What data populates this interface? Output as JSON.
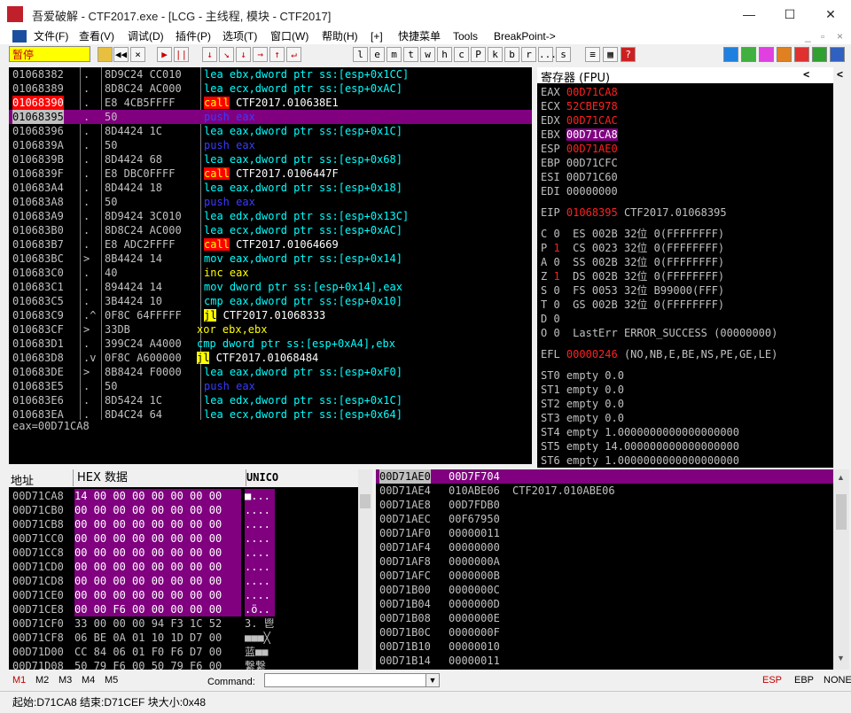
{
  "window": {
    "title": "吾爱破解 - CTF2017.exe - [LCG - 主线程, 模块 - CTF2017]",
    "min": "—",
    "max": "☐",
    "close": "✕"
  },
  "menu": [
    "文件(F)",
    "查看(V)",
    "调试(D)",
    "插件(P)",
    "选项(T)",
    "窗口(W)",
    "帮助(H)",
    "[+]",
    "快捷菜单",
    "Tools",
    "BreakPoint->"
  ],
  "mdi_controls": [
    "_",
    "▫",
    "×"
  ],
  "toolbar": {
    "status": "暂停",
    "debug_buttons": [
      "◀◀",
      "×",
      "▶",
      "||",
      "↓",
      "↘",
      "↓",
      "→",
      "↑",
      "↵"
    ],
    "letter_buttons": [
      "l",
      "e",
      "m",
      "t",
      "w",
      "h",
      "c",
      "P",
      "k",
      "b",
      "r",
      "...",
      "s"
    ]
  },
  "cpu": {
    "rows": [
      {
        "addr": "01068382",
        "mark": ".",
        "hex": "8D9C24 CC010",
        "dis": [
          [
            "lea ebx,dword ptr ss:[esp+0x1CC]",
            "cyan"
          ]
        ]
      },
      {
        "addr": "01068389",
        "mark": ".",
        "hex": "8D8C24 AC000",
        "dis": [
          [
            "lea ecx,dword ptr ss:[esp+0xAC]",
            "cyan"
          ]
        ]
      },
      {
        "addr": "01068390",
        "mark": ".",
        "hex": "E8 4CB5FFFF",
        "addr_hl": "red",
        "dis": [
          [
            "call",
            "callhl"
          ],
          [
            " CTF2017.010638E1",
            "white"
          ]
        ]
      },
      {
        "addr": "01068395",
        "mark": ".",
        "hex": "50",
        "row_hl": "purple",
        "dis": [
          [
            "push eax",
            "blue"
          ]
        ]
      },
      {
        "addr": "01068396",
        "mark": ".",
        "hex": "8D4424 1C",
        "dis": [
          [
            "lea eax,dword ptr ss:[esp+0x1C]",
            "cyan"
          ]
        ]
      },
      {
        "addr": "0106839A",
        "mark": ".",
        "hex": "50",
        "dis": [
          [
            "push eax",
            "blue"
          ]
        ]
      },
      {
        "addr": "0106839B",
        "mark": ".",
        "hex": "8D4424 68",
        "dis": [
          [
            "lea eax,dword ptr ss:[esp+0x68]",
            "cyan"
          ]
        ]
      },
      {
        "addr": "0106839F",
        "mark": ".",
        "hex": "E8 DBC0FFFF",
        "dis": [
          [
            "call",
            "callhl"
          ],
          [
            " CTF2017.0106447F",
            "white"
          ]
        ]
      },
      {
        "addr": "010683A4",
        "mark": ".",
        "hex": "8D4424 18",
        "dis": [
          [
            "lea eax,dword ptr ss:[esp+0x18]",
            "cyan"
          ]
        ]
      },
      {
        "addr": "010683A8",
        "mark": ".",
        "hex": "50",
        "dis": [
          [
            "push eax",
            "blue"
          ]
        ]
      },
      {
        "addr": "010683A9",
        "mark": ".",
        "hex": "8D9424 3C010",
        "dis": [
          [
            "lea edx,dword ptr ss:[esp+0x13C]",
            "cyan"
          ]
        ]
      },
      {
        "addr": "010683B0",
        "mark": ".",
        "hex": "8D8C24 AC000",
        "dis": [
          [
            "lea ecx,dword ptr ss:[esp+0xAC]",
            "cyan"
          ]
        ]
      },
      {
        "addr": "010683B7",
        "mark": ".",
        "hex": "E8 ADC2FFFF",
        "dis": [
          [
            "call",
            "callhl"
          ],
          [
            " CTF2017.01064669",
            "white"
          ]
        ]
      },
      {
        "addr": "010683BC",
        "mark": ">",
        "hex": "8B4424 14",
        "dis": [
          [
            "mov eax,dword ptr ss:[esp+0x14]",
            "cyan"
          ]
        ]
      },
      {
        "addr": "010683C0",
        "mark": ".",
        "hex": "40",
        "dis": [
          [
            "inc eax",
            "yellow"
          ]
        ]
      },
      {
        "addr": "010683C1",
        "mark": ".",
        "hex": "894424 14",
        "dis": [
          [
            "mov dword ptr ss:[esp+0x14],eax",
            "cyan"
          ]
        ]
      },
      {
        "addr": "010683C5",
        "mark": ".",
        "hex": "3B4424 10",
        "dis": [
          [
            "cmp eax,dword ptr ss:[esp+0x10]",
            "cyan"
          ]
        ]
      },
      {
        "addr": "010683C9",
        "mark": ".^",
        "hex": "0F8C 64FFFFF",
        "dis": [
          [
            "jl",
            "jhl"
          ],
          [
            " CTF2017.01068333",
            "white"
          ]
        ]
      },
      {
        "addr": "010683CF",
        "mark": ">",
        "hex": "33DB",
        "dis": [
          [
            "xor ebx,ebx",
            "yellow"
          ]
        ],
        "dis_left": true
      },
      {
        "addr": "010683D1",
        "mark": ".",
        "hex": "399C24 A4000",
        "dis": [
          [
            "cmp dword ptr ss:[esp+0xA4],ebx",
            "cyan"
          ]
        ],
        "dis_left": true
      },
      {
        "addr": "010683D8",
        "mark": ".v",
        "hex": "0F8C A600000",
        "dis": [
          [
            "jl",
            "jhl"
          ],
          [
            " CTF2017.01068484",
            "white"
          ]
        ],
        "dis_left": true
      },
      {
        "addr": "010683DE",
        "mark": ">",
        "hex": "8B8424 F0000",
        "dis": [
          [
            "lea eax,dword ptr ss:[esp+0xF0]",
            "cyan"
          ]
        ]
      },
      {
        "addr": "010683E5",
        "mark": ".",
        "hex": "50",
        "dis": [
          [
            "push eax",
            "blue"
          ]
        ]
      },
      {
        "addr": "010683E6",
        "mark": ".",
        "hex": "8D5424 1C",
        "dis": [
          [
            "lea edx,dword ptr ss:[esp+0x1C]",
            "cyan"
          ]
        ]
      },
      {
        "addr": "010683EA",
        "mark": ".",
        "hex": "8D4C24 64",
        "dis": [
          [
            "lea ecx,dword ptr ss:[esp+0x64]",
            "cyan"
          ]
        ]
      }
    ],
    "info": "eax=00D71CA8"
  },
  "registers": {
    "header": "寄存器 (FPU)",
    "nav_left": "<",
    "nav_right": "<",
    "gp": [
      [
        "EAX",
        "00D71CA8",
        "red"
      ],
      [
        "ECX",
        "52CBE978",
        "red"
      ],
      [
        "EDX",
        "00D71CAC",
        "red"
      ],
      [
        "EBX",
        "00D71CA8",
        "purple"
      ],
      [
        "ESP",
        "00D71AE0",
        "red"
      ],
      [
        "EBP",
        "00D71CFC",
        ""
      ],
      [
        "ESI",
        "00D71C60",
        ""
      ],
      [
        "EDI",
        "00000000",
        ""
      ]
    ],
    "eip": [
      "EIP",
      "01068395",
      "CTF2017.01068395"
    ],
    "flags": [
      [
        "C",
        "0",
        "ES",
        "002B",
        "32位",
        "0(FFFFFFFF)"
      ],
      [
        "P",
        "1",
        "CS",
        "0023",
        "32位",
        "0(FFFFFFFF)"
      ],
      [
        "A",
        "0",
        "SS",
        "002B",
        "32位",
        "0(FFFFFFFF)"
      ],
      [
        "Z",
        "1",
        "DS",
        "002B",
        "32位",
        "0(FFFFFFFF)"
      ],
      [
        "S",
        "0",
        "FS",
        "0053",
        "32位",
        "B99000(FFF)"
      ],
      [
        "T",
        "0",
        "GS",
        "002B",
        "32位",
        "0(FFFFFFFF)"
      ],
      [
        "D",
        "0",
        "",
        "",
        "",
        ""
      ],
      [
        "O",
        "0",
        "LastErr",
        "ERROR_SUCCESS (00000000)",
        "",
        ""
      ]
    ],
    "efl": [
      "EFL",
      "00000246",
      "(NO,NB,E,BE,NS,PE,GE,LE)"
    ],
    "fpu": [
      [
        "ST0",
        "empty",
        "0.0"
      ],
      [
        "ST1",
        "empty",
        "0.0"
      ],
      [
        "ST2",
        "empty",
        "0.0"
      ],
      [
        "ST3",
        "empty",
        "0.0"
      ],
      [
        "ST4",
        "empty",
        "1.0000000000000000000"
      ],
      [
        "ST5",
        "empty",
        "14.000000000000000000"
      ],
      [
        "ST6",
        "empty",
        "1.0000000000000000000"
      ]
    ]
  },
  "dump": {
    "headers": [
      "地址",
      "HEX 数据",
      "UNICO"
    ],
    "rows": [
      [
        "00D71CA8",
        "14 00 00 00 00 00 00 00",
        "■...",
        true
      ],
      [
        "00D71CB0",
        "00 00 00 00 00 00 00 00",
        "....",
        true
      ],
      [
        "00D71CB8",
        "00 00 00 00 00 00 00 00",
        "....",
        true
      ],
      [
        "00D71CC0",
        "00 00 00 00 00 00 00 00",
        "....",
        true
      ],
      [
        "00D71CC8",
        "00 00 00 00 00 00 00 00",
        "....",
        true
      ],
      [
        "00D71CD0",
        "00 00 00 00 00 00 00 00",
        "....",
        true
      ],
      [
        "00D71CD8",
        "00 00 00 00 00 00 00 00",
        "....",
        true
      ],
      [
        "00D71CE0",
        "00 00 00 00 00 00 00 00",
        "....",
        true
      ],
      [
        "00D71CE8",
        "00 00 F6 00 00 00 00 00",
        ".ö..",
        true
      ],
      [
        "00D71CF0",
        "33 00 00 00 94 F3 1C 52",
        "3. 鬯",
        false
      ],
      [
        "00D71CF8",
        "06 BE 0A 01 10 1D D7 00",
        "■■■╳",
        false
      ],
      [
        "00D71D00",
        "CC 84 06 01 F0 F6 D7 00",
        "蓝■■",
        false
      ],
      [
        "00D71D08",
        "50 79 F6 00 50 79 F6 00",
        "繋繋",
        false
      ]
    ]
  },
  "stack": {
    "rows": [
      [
        "00D71AE0",
        "00D7F704",
        "",
        true
      ],
      [
        "00D71AE4",
        "010ABE06",
        "CTF2017.010ABE06",
        false
      ],
      [
        "00D71AE8",
        "00D7FDB0",
        "",
        false
      ],
      [
        "00D71AEC",
        "00F67950",
        "",
        false
      ],
      [
        "00D71AF0",
        "00000011",
        "",
        false
      ],
      [
        "00D71AF4",
        "00000000",
        "",
        false
      ],
      [
        "00D71AF8",
        "0000000A",
        "",
        false
      ],
      [
        "00D71AFC",
        "0000000B",
        "",
        false
      ],
      [
        "00D71B00",
        "0000000C",
        "",
        false
      ],
      [
        "00D71B04",
        "0000000D",
        "",
        false
      ],
      [
        "00D71B08",
        "0000000E",
        "",
        false
      ],
      [
        "00D71B0C",
        "0000000F",
        "",
        false
      ],
      [
        "00D71B10",
        "00000010",
        "",
        false
      ],
      [
        "00D71B14",
        "00000011",
        "",
        false
      ]
    ]
  },
  "cmdbar": {
    "m_tabs": [
      "M1",
      "M2",
      "M3",
      "M4",
      "M5"
    ],
    "command_label": "Command:",
    "command_value": "",
    "right": [
      "ESP",
      "EBP",
      "NONE"
    ]
  },
  "status": "起始:D71CA8 结束:D71CEF 块大小:0x48",
  "colors": {
    "cyan": "#00ffff",
    "blue": "#3b3bff",
    "yellow": "#ffff00",
    "white": "#ffffff",
    "purple": "#800080",
    "red": "#ff0000"
  }
}
